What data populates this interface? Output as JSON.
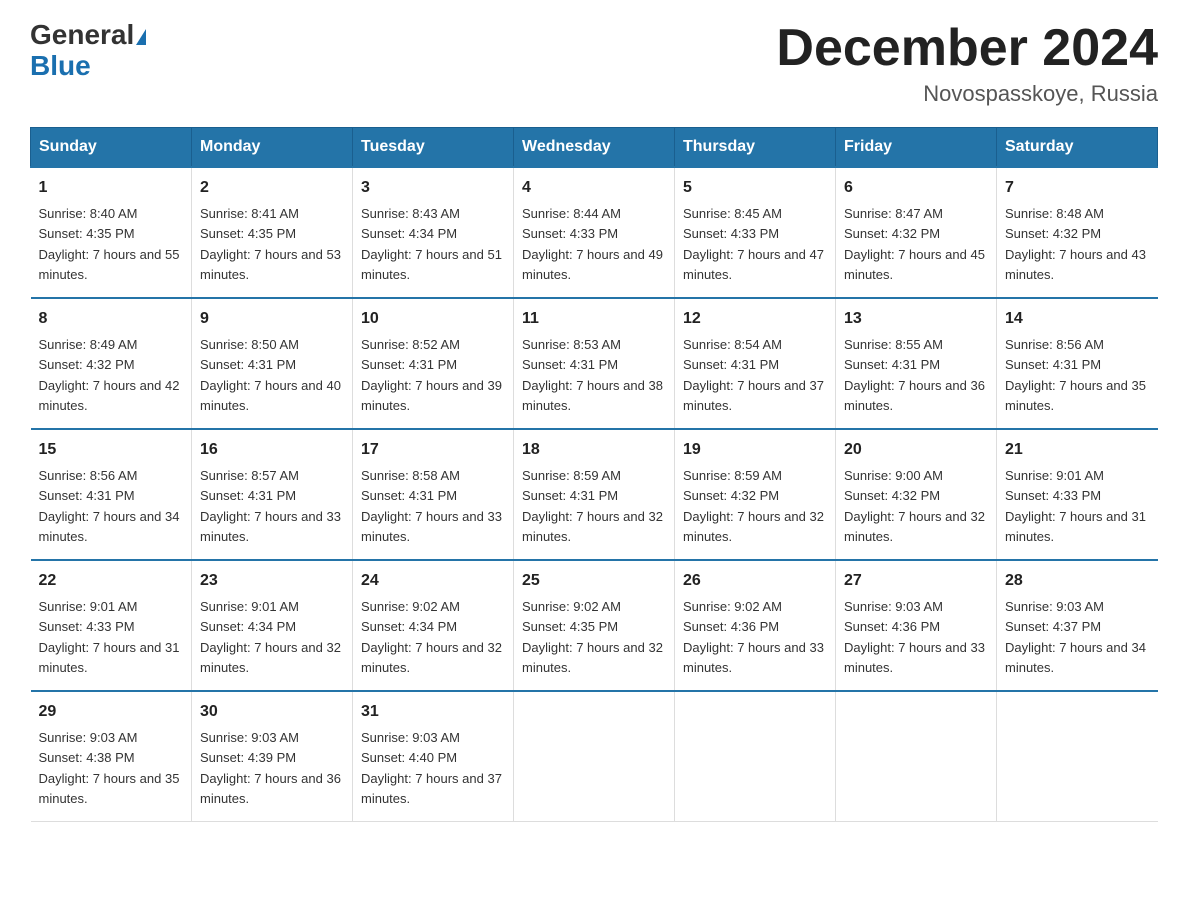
{
  "header": {
    "logo_general": "General",
    "logo_blue": "Blue",
    "month_title": "December 2024",
    "location": "Novospasskoye, Russia"
  },
  "days_of_week": [
    "Sunday",
    "Monday",
    "Tuesday",
    "Wednesday",
    "Thursday",
    "Friday",
    "Saturday"
  ],
  "weeks": [
    [
      {
        "day": "1",
        "sunrise": "8:40 AM",
        "sunset": "4:35 PM",
        "daylight": "7 hours and 55 minutes."
      },
      {
        "day": "2",
        "sunrise": "8:41 AM",
        "sunset": "4:35 PM",
        "daylight": "7 hours and 53 minutes."
      },
      {
        "day": "3",
        "sunrise": "8:43 AM",
        "sunset": "4:34 PM",
        "daylight": "7 hours and 51 minutes."
      },
      {
        "day": "4",
        "sunrise": "8:44 AM",
        "sunset": "4:33 PM",
        "daylight": "7 hours and 49 minutes."
      },
      {
        "day": "5",
        "sunrise": "8:45 AM",
        "sunset": "4:33 PM",
        "daylight": "7 hours and 47 minutes."
      },
      {
        "day": "6",
        "sunrise": "8:47 AM",
        "sunset": "4:32 PM",
        "daylight": "7 hours and 45 minutes."
      },
      {
        "day": "7",
        "sunrise": "8:48 AM",
        "sunset": "4:32 PM",
        "daylight": "7 hours and 43 minutes."
      }
    ],
    [
      {
        "day": "8",
        "sunrise": "8:49 AM",
        "sunset": "4:32 PM",
        "daylight": "7 hours and 42 minutes."
      },
      {
        "day": "9",
        "sunrise": "8:50 AM",
        "sunset": "4:31 PM",
        "daylight": "7 hours and 40 minutes."
      },
      {
        "day": "10",
        "sunrise": "8:52 AM",
        "sunset": "4:31 PM",
        "daylight": "7 hours and 39 minutes."
      },
      {
        "day": "11",
        "sunrise": "8:53 AM",
        "sunset": "4:31 PM",
        "daylight": "7 hours and 38 minutes."
      },
      {
        "day": "12",
        "sunrise": "8:54 AM",
        "sunset": "4:31 PM",
        "daylight": "7 hours and 37 minutes."
      },
      {
        "day": "13",
        "sunrise": "8:55 AM",
        "sunset": "4:31 PM",
        "daylight": "7 hours and 36 minutes."
      },
      {
        "day": "14",
        "sunrise": "8:56 AM",
        "sunset": "4:31 PM",
        "daylight": "7 hours and 35 minutes."
      }
    ],
    [
      {
        "day": "15",
        "sunrise": "8:56 AM",
        "sunset": "4:31 PM",
        "daylight": "7 hours and 34 minutes."
      },
      {
        "day": "16",
        "sunrise": "8:57 AM",
        "sunset": "4:31 PM",
        "daylight": "7 hours and 33 minutes."
      },
      {
        "day": "17",
        "sunrise": "8:58 AM",
        "sunset": "4:31 PM",
        "daylight": "7 hours and 33 minutes."
      },
      {
        "day": "18",
        "sunrise": "8:59 AM",
        "sunset": "4:31 PM",
        "daylight": "7 hours and 32 minutes."
      },
      {
        "day": "19",
        "sunrise": "8:59 AM",
        "sunset": "4:32 PM",
        "daylight": "7 hours and 32 minutes."
      },
      {
        "day": "20",
        "sunrise": "9:00 AM",
        "sunset": "4:32 PM",
        "daylight": "7 hours and 32 minutes."
      },
      {
        "day": "21",
        "sunrise": "9:01 AM",
        "sunset": "4:33 PM",
        "daylight": "7 hours and 31 minutes."
      }
    ],
    [
      {
        "day": "22",
        "sunrise": "9:01 AM",
        "sunset": "4:33 PM",
        "daylight": "7 hours and 31 minutes."
      },
      {
        "day": "23",
        "sunrise": "9:01 AM",
        "sunset": "4:34 PM",
        "daylight": "7 hours and 32 minutes."
      },
      {
        "day": "24",
        "sunrise": "9:02 AM",
        "sunset": "4:34 PM",
        "daylight": "7 hours and 32 minutes."
      },
      {
        "day": "25",
        "sunrise": "9:02 AM",
        "sunset": "4:35 PM",
        "daylight": "7 hours and 32 minutes."
      },
      {
        "day": "26",
        "sunrise": "9:02 AM",
        "sunset": "4:36 PM",
        "daylight": "7 hours and 33 minutes."
      },
      {
        "day": "27",
        "sunrise": "9:03 AM",
        "sunset": "4:36 PM",
        "daylight": "7 hours and 33 minutes."
      },
      {
        "day": "28",
        "sunrise": "9:03 AM",
        "sunset": "4:37 PM",
        "daylight": "7 hours and 34 minutes."
      }
    ],
    [
      {
        "day": "29",
        "sunrise": "9:03 AM",
        "sunset": "4:38 PM",
        "daylight": "7 hours and 35 minutes."
      },
      {
        "day": "30",
        "sunrise": "9:03 AM",
        "sunset": "4:39 PM",
        "daylight": "7 hours and 36 minutes."
      },
      {
        "day": "31",
        "sunrise": "9:03 AM",
        "sunset": "4:40 PM",
        "daylight": "7 hours and 37 minutes."
      },
      null,
      null,
      null,
      null
    ]
  ]
}
